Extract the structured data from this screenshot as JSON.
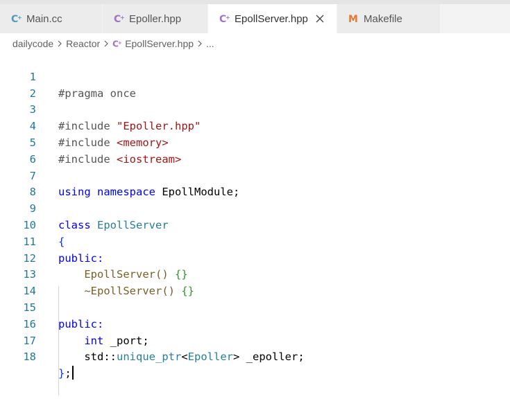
{
  "tabs": [
    {
      "label": "Main.cc",
      "icon": "cpp-file-icon",
      "active": false
    },
    {
      "label": "Epoller.hpp",
      "icon": "cpp-header-icon",
      "active": false
    },
    {
      "label": "EpollServer.hpp",
      "icon": "cpp-header-icon",
      "active": true
    },
    {
      "label": "Makefile",
      "icon": "makefile-icon",
      "active": false
    }
  ],
  "breadcrumb": {
    "items": [
      "dailycode",
      "Reactor",
      "EpollServer.hpp",
      "..."
    ]
  },
  "colors": {
    "line_number": "#237893",
    "keyword": "#0000ff",
    "string": "#a31515",
    "type": "#267f99",
    "function": "#795e26",
    "makefile_icon": "#e37933",
    "cpp_icon": "#a074c4"
  },
  "code": {
    "line_numbers": [
      "1",
      "2",
      "3",
      "4",
      "5",
      "6",
      "7",
      "8",
      "9",
      "10",
      "11",
      "12",
      "13",
      "14",
      "15",
      "16",
      "17",
      "18"
    ],
    "l1": {
      "a": "#pragma once"
    },
    "l3": {
      "a": "#include",
      "b": " ",
      "c": "\"Epoller.hpp\""
    },
    "l4": {
      "a": "#include",
      "b": " ",
      "c": "<memory>"
    },
    "l5": {
      "a": "#include",
      "b": " ",
      "c": "<iostream>"
    },
    "l7": {
      "a": "using",
      "b": " ",
      "c": "namespace",
      "d": " EpollModule;"
    },
    "l9": {
      "a": "class",
      "b": " ",
      "c": "EpollServer"
    },
    "l10": {
      "a": "{"
    },
    "l11": {
      "a": "public:"
    },
    "l12": {
      "indent": "    ",
      "a": "EpollServer",
      "b": "()",
      "c": " ",
      "d": "{}"
    },
    "l13": {
      "indent": "    ",
      "a": "~EpollServer",
      "b": "()",
      "c": " ",
      "d": "{}"
    },
    "l15": {
      "a": "public:"
    },
    "l16": {
      "indent": "    ",
      "a": "int",
      "b": " _port;"
    },
    "l17": {
      "indent": "    ",
      "a": "std::",
      "b": "unique_ptr",
      "c": "<",
      "d": "Epoller",
      "e": ">",
      "f": " _epoller;"
    },
    "l18": {
      "a": "}",
      "b": ";"
    }
  }
}
